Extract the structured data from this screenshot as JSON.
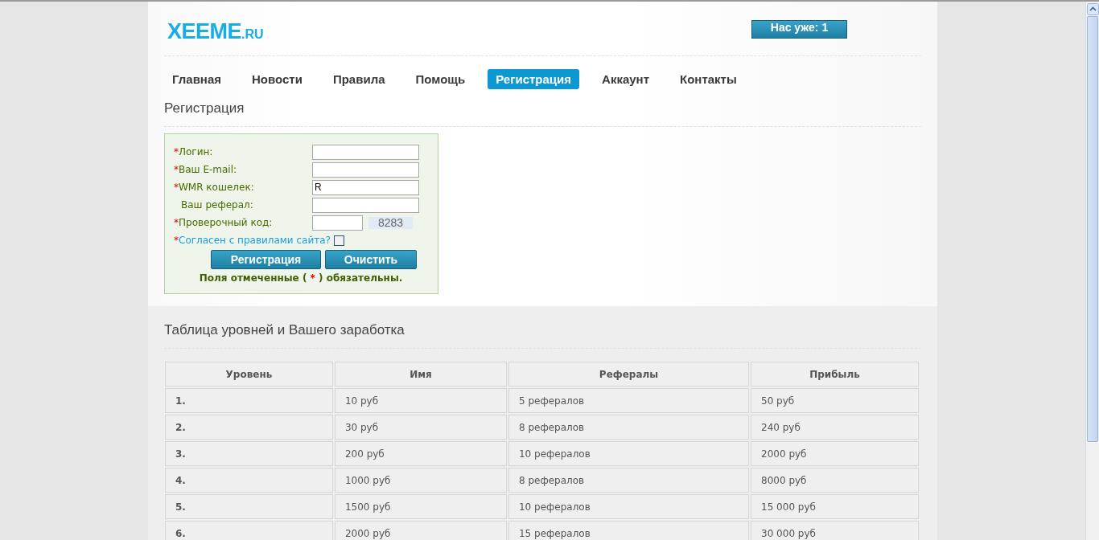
{
  "logo": {
    "name": "XEEME",
    "suffix": ".RU"
  },
  "counter": "Нас уже: 1",
  "nav": [
    {
      "label": "Главная",
      "selected": false
    },
    {
      "label": "Новости",
      "selected": false
    },
    {
      "label": "Правила",
      "selected": false
    },
    {
      "label": "Помощь",
      "selected": false
    },
    {
      "label": "Регистрация",
      "selected": true
    },
    {
      "label": "Аккаунт",
      "selected": false
    },
    {
      "label": "Контакты",
      "selected": false
    }
  ],
  "page_title": "Регистрация",
  "form": {
    "fields": [
      {
        "mark": "*",
        "label": "Логин:",
        "kind": "text"
      },
      {
        "mark": "*",
        "label": "Ваш E-mail:",
        "kind": "text"
      },
      {
        "mark": "*",
        "label": "WMR кошелек:",
        "kind": "text",
        "value": "R"
      },
      {
        "label": "Ваш реферал:",
        "kind": "text"
      },
      {
        "mark": "*",
        "label": "Проверочный код:",
        "kind": "captcha",
        "code": "8283"
      }
    ],
    "agreement": {
      "mark": "*",
      "label": "Согласен с правилами сайта?",
      "checked": false
    },
    "buttons": [
      "Регистрация",
      "Очистить"
    ],
    "note": {
      "before": "Поля отмеченные (",
      "mark": "*",
      "after": ") обязательны."
    }
  },
  "table_title": "Таблица уровней и Вашего заработка",
  "table": {
    "columns": [
      "Уровень",
      "Имя",
      "Рефералы",
      "Прибыль"
    ],
    "rows": [
      [
        "1.",
        "10 руб",
        "5 рефералов",
        "50 руб"
      ],
      [
        "2.",
        "30 руб",
        "8 рефералов",
        "240 руб"
      ],
      [
        "3.",
        "200 руб",
        "10 рефералов",
        "2000 руб"
      ],
      [
        "4.",
        "1000 руб",
        "8 рефералов",
        "8000 руб"
      ],
      [
        "5.",
        "1500 руб",
        "10 рефералов",
        "15 000 руб"
      ],
      [
        "6.",
        "2000 руб",
        "15 рефералов",
        "30 000 руб"
      ]
    ]
  }
}
